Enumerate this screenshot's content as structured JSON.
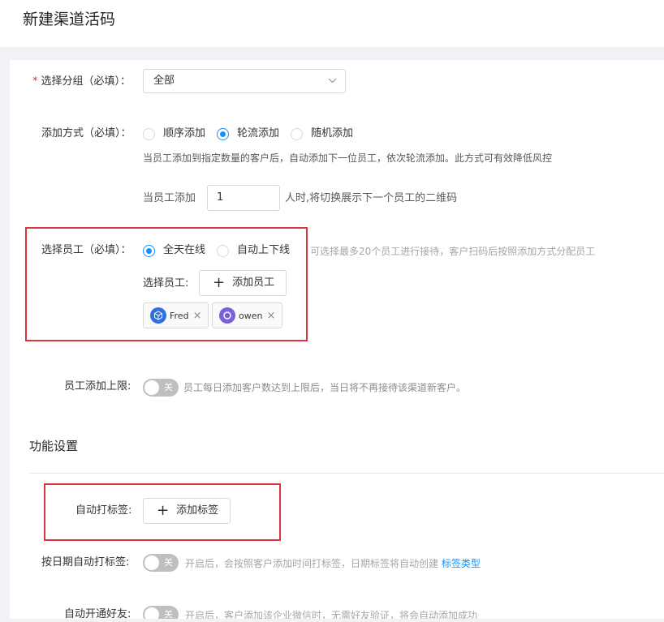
{
  "page": {
    "title": "新建渠道活码"
  },
  "group": {
    "label": "选择分组（必填）：",
    "required_mark": "*",
    "value": "全部",
    "chevron_icon": "chevron-down-icon"
  },
  "add_mode": {
    "label": "添加方式（必填）：",
    "options": [
      "顺序添加",
      "轮流添加",
      "随机添加"
    ],
    "selected": "轮流添加",
    "description": "当员工添加到指定数量的客户后，自动添加下一位员工，依次轮流添加。此方式可有效降低风控",
    "switch_prefix": "当员工添加",
    "switch_value": "1",
    "switch_suffix": "人时,将切换展示下一个员工的二维码"
  },
  "staff": {
    "label": "选择员工（必填）：",
    "options": [
      "全天在线",
      "自动上下线"
    ],
    "selected": "全天在线",
    "hint": "可选择最多20个员工进行接待，客户扫码后按照添加方式分配员工",
    "select_label": "选择员工:",
    "add_button": "添加员工",
    "members": [
      {
        "name": "Fred",
        "avatar_color": "#2f6fe0"
      },
      {
        "name": "owen",
        "avatar_color": "#7b5fd9"
      }
    ],
    "remove_glyph": "×"
  },
  "limit": {
    "label": "员工添加上限:",
    "switch_text": "关",
    "description": "员工每日添加客户数达到上限后，当日将不再接待该渠道新客户。"
  },
  "features": {
    "section_title": "功能设置",
    "auto_tag": {
      "label": "自动打标签:",
      "button": "添加标签"
    },
    "date_tag": {
      "label": "按日期自动打标签:",
      "switch_text": "关",
      "description": "开启后，会按照客户添加时间打标签，日期标签将自动创建",
      "link": "标签类型"
    },
    "auto_friend": {
      "label": "自动开通好友:",
      "switch_text": "关",
      "description": "开启后，客户添加该企业微信时，无需好友验证，将会自动添加成功"
    }
  },
  "colors": {
    "primary": "#1890ff",
    "required": "#f5222d",
    "highlight_box": "#d9363e"
  }
}
